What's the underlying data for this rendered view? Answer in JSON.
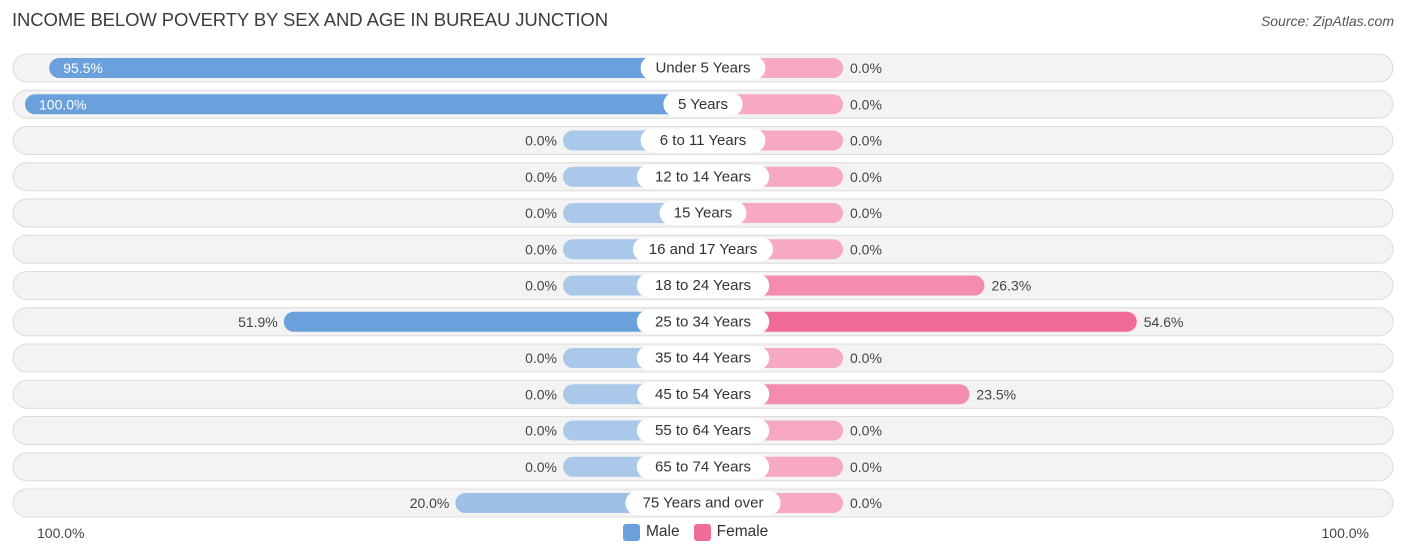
{
  "header": {
    "title": "INCOME BELOW POVERTY BY SEX AND AGE IN BUREAU JUNCTION",
    "source": "Source: ZipAtlas.com"
  },
  "colors": {
    "male_strong": "#6aa1dc",
    "male_light": "#a9c8ea",
    "female_strong": "#f06b97",
    "female_light": "#f6a9c1"
  },
  "axis": {
    "left_label": "100.0%",
    "right_label": "100.0%"
  },
  "legend": {
    "male": "Male",
    "female": "Female"
  },
  "chart_data": {
    "type": "bar",
    "orientation": "horizontal-diverging",
    "title": "INCOME BELOW POVERTY BY SEX AND AGE IN BUREAU JUNCTION",
    "xlim": [
      -100,
      100
    ],
    "legend_position": "bottom-center",
    "categories": [
      "Under 5 Years",
      "5 Years",
      "6 to 11 Years",
      "12 to 14 Years",
      "15 Years",
      "16 and 17 Years",
      "18 to 24 Years",
      "25 to 34 Years",
      "35 to 44 Years",
      "45 to 54 Years",
      "55 to 64 Years",
      "65 to 74 Years",
      "75 Years and over"
    ],
    "series": [
      {
        "name": "Male",
        "values": [
          95.5,
          100.0,
          0.0,
          0.0,
          0.0,
          0.0,
          0.0,
          51.9,
          0.0,
          0.0,
          0.0,
          0.0,
          20.0
        ],
        "labels": [
          "95.5%",
          "100.0%",
          "0.0%",
          "0.0%",
          "0.0%",
          "0.0%",
          "0.0%",
          "51.9%",
          "0.0%",
          "0.0%",
          "0.0%",
          "0.0%",
          "20.0%"
        ]
      },
      {
        "name": "Female",
        "values": [
          0.0,
          0.0,
          0.0,
          0.0,
          0.0,
          0.0,
          26.3,
          54.6,
          0.0,
          23.5,
          0.0,
          0.0,
          0.0
        ],
        "labels": [
          "0.0%",
          "0.0%",
          "0.0%",
          "0.0%",
          "0.0%",
          "0.0%",
          "26.3%",
          "54.6%",
          "0.0%",
          "23.5%",
          "0.0%",
          "0.0%",
          "0.0%"
        ]
      }
    ]
  }
}
